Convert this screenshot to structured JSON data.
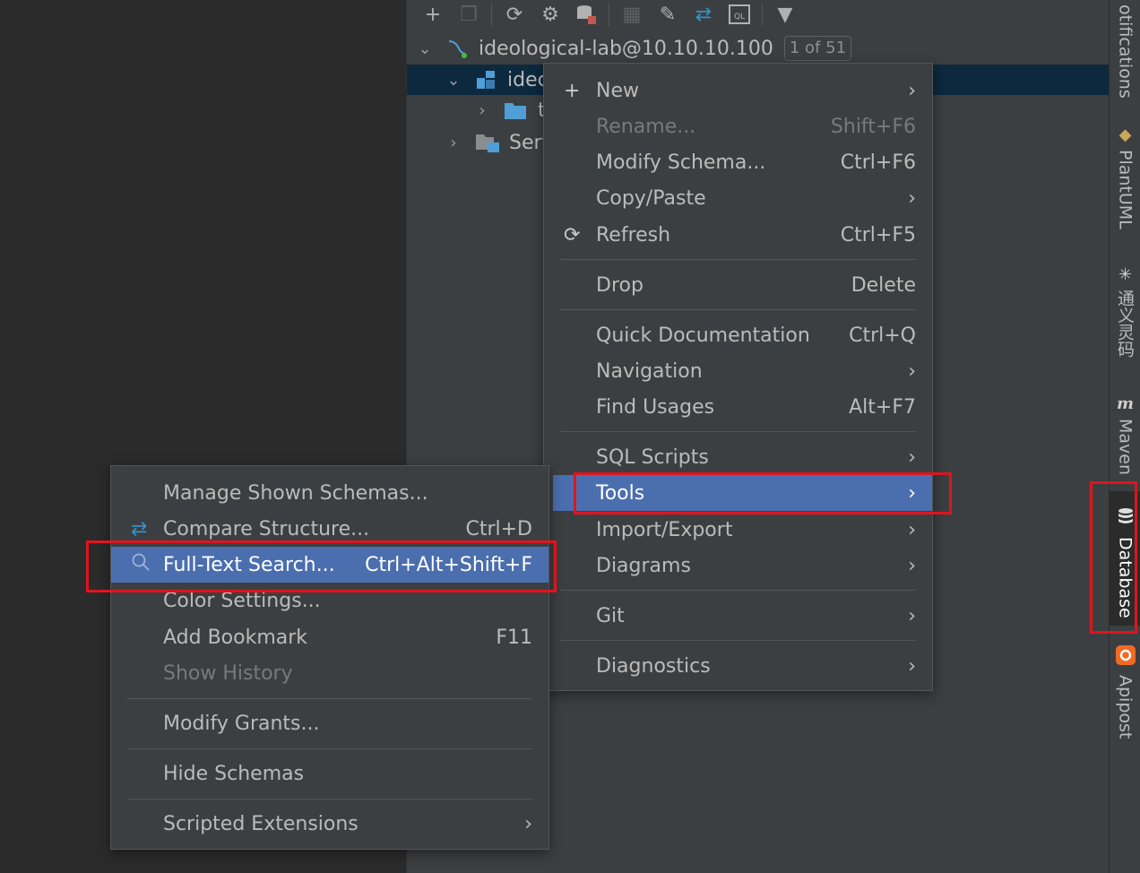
{
  "toolbar": {
    "icons": [
      "add-icon",
      "copy-icon",
      "refresh-icon",
      "schema-sync-icon",
      "stop-icon",
      "table-icon",
      "edit-icon",
      "compare-icon",
      "query-console-icon",
      "filter-icon"
    ]
  },
  "tree": {
    "connection": {
      "label": "ideological-lab@10.10.10.100",
      "badge": "1 of 51"
    },
    "schema_label": "idec",
    "folder_label": "t",
    "server_label": "Serv"
  },
  "context_menu": {
    "items": [
      {
        "label": "New",
        "shortcut": "",
        "submenu": true,
        "icon": "plus-icon"
      },
      {
        "label": "Rename...",
        "shortcut": "Shift+F6",
        "disabled": true
      },
      {
        "label": "Modify Schema...",
        "shortcut": "Ctrl+F6"
      },
      {
        "label": "Copy/Paste",
        "shortcut": "",
        "submenu": true
      },
      {
        "label": "Refresh",
        "shortcut": "Ctrl+F5",
        "icon": "refresh-icon"
      },
      {
        "label": "Drop",
        "shortcut": "Delete"
      },
      {
        "label": "Quick Documentation",
        "shortcut": "Ctrl+Q"
      },
      {
        "label": "Navigation",
        "shortcut": "",
        "submenu": true
      },
      {
        "label": "Find Usages",
        "shortcut": "Alt+F7"
      },
      {
        "label": "SQL Scripts",
        "shortcut": "",
        "submenu": true
      },
      {
        "label": "Tools",
        "shortcut": "",
        "submenu": true,
        "active": true
      },
      {
        "label": "Import/Export",
        "shortcut": "",
        "submenu": true
      },
      {
        "label": "Diagrams",
        "shortcut": "",
        "submenu": true
      },
      {
        "label": "Git",
        "shortcut": "",
        "submenu": true
      },
      {
        "label": "Diagnostics",
        "shortcut": "",
        "submenu": true
      }
    ]
  },
  "tools_submenu": {
    "items": [
      {
        "label": "Manage Shown Schemas...",
        "shortcut": ""
      },
      {
        "label": "Compare Structure...",
        "shortcut": "Ctrl+D",
        "icon": "compare-icon"
      },
      {
        "label": "Full-Text Search...",
        "shortcut": "Ctrl+Alt+Shift+F",
        "icon": "search-icon",
        "active": true
      },
      {
        "label": "Color Settings...",
        "shortcut": ""
      },
      {
        "label": "Add Bookmark",
        "shortcut": "F11"
      },
      {
        "label": "Show History",
        "shortcut": "",
        "disabled": true
      },
      {
        "label": "Modify Grants...",
        "shortcut": ""
      },
      {
        "label": "Hide Schemas",
        "shortcut": ""
      },
      {
        "label": "Scripted Extensions",
        "shortcut": "",
        "submenu": true
      }
    ]
  },
  "right_strip": {
    "tabs": [
      {
        "label": "otifications",
        "icon": ""
      },
      {
        "label": "PlantUML",
        "icon": "plantuml-icon"
      },
      {
        "label": "通义灵码",
        "icon": "tongyi-icon"
      },
      {
        "label": "Maven",
        "icon": "maven-icon"
      },
      {
        "label": "Database",
        "icon": "database-icon",
        "active": true
      },
      {
        "label": "Apipost",
        "icon": "apipost-icon"
      }
    ]
  },
  "colors": {
    "highlight_box": "#e0141e",
    "menu_active": "#4b6eaf",
    "menu_bg": "#3c3f41"
  }
}
